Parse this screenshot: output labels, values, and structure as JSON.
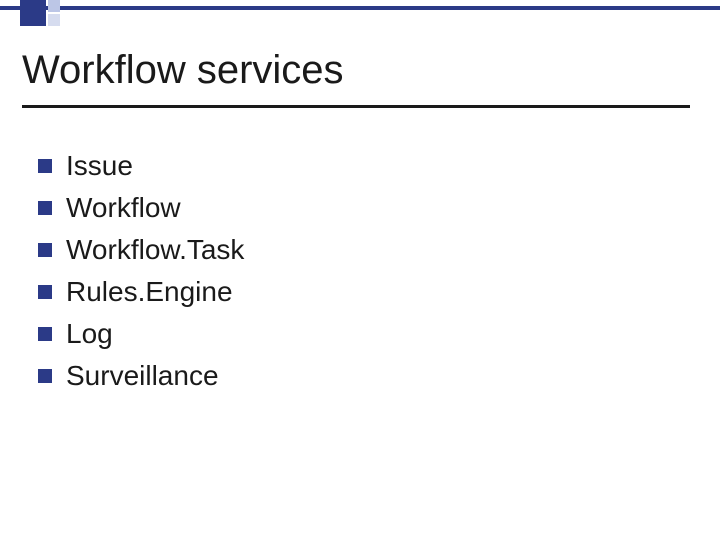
{
  "title": "Workflow services",
  "items": [
    {
      "label": "Issue"
    },
    {
      "label": "Workflow"
    },
    {
      "label": "Workflow.Task"
    },
    {
      "label": "Rules.Engine"
    },
    {
      "label": "Log"
    },
    {
      "label": "Surveillance"
    }
  ]
}
